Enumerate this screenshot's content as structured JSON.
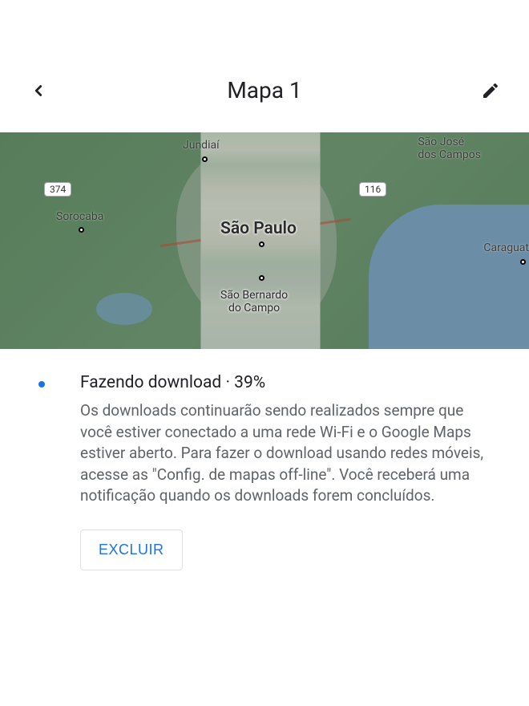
{
  "header": {
    "title": "Mapa 1"
  },
  "map": {
    "labels": {
      "jundiai": "Jundiaí",
      "sao_jose": "São José\ndos Campos",
      "sorocaba": "Sorocaba",
      "sao_paulo": "São Paulo",
      "caraguat": "Caraguat",
      "sao_bernardo": "São Bernardo\ndo Campo"
    },
    "roads": {
      "r374": "374",
      "r116": "116"
    }
  },
  "download": {
    "status_label": "Fazendo download",
    "separator": " · ",
    "percent": "39%",
    "description": "Os downloads continuarão sendo realizados sempre que você estiver conectado a uma rede Wi-Fi e o Google Maps estiver aberto. Para fazer o download usando redes móveis, acesse as \"Config. de mapas off-line\". Você receberá uma notificação quando os downloads forem concluídos.",
    "delete_label": "EXCLUIR"
  }
}
